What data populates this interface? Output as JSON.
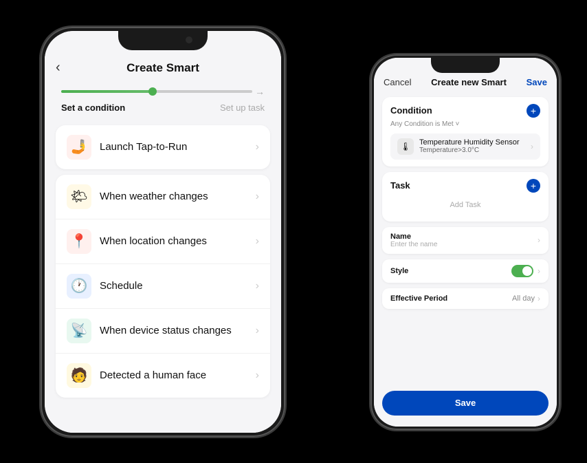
{
  "phone1": {
    "title": "Create Smart",
    "back_icon": "‹",
    "progress": {
      "step1_label": "Set a condition",
      "step2_label": "Set up task"
    },
    "rows": [
      {
        "id": "tap-to-run",
        "icon": "🤳",
        "icon_bg": "#fff0ee",
        "label": "Launch Tap-to-Run"
      },
      {
        "id": "weather",
        "icon": "🌤",
        "icon_bg": "#fff9e6",
        "label": "When weather changes"
      },
      {
        "id": "location",
        "icon": "📍",
        "icon_bg": "#fff0ee",
        "label": "When location changes"
      },
      {
        "id": "schedule",
        "icon": "🕐",
        "icon_bg": "#e8f0ff",
        "label": "Schedule"
      },
      {
        "id": "device-status",
        "icon": "📡",
        "icon_bg": "#e8f8f0",
        "label": "When device status changes"
      },
      {
        "id": "human-face",
        "icon": "🧑",
        "icon_bg": "#fff9e0",
        "label": "Detected a human face"
      }
    ]
  },
  "phone2": {
    "header": {
      "cancel": "Cancel",
      "title": "Create new Smart",
      "save": "Save"
    },
    "condition": {
      "section_title": "Condition",
      "subtitle": "Any Condition is Met ˅",
      "plus_icon": "+",
      "item": {
        "icon": "🌡",
        "name": "Temperature Humidity Sensor",
        "value": "Temperature>3.0°C",
        "chevron": "›"
      }
    },
    "task": {
      "section_title": "Task",
      "plus_icon": "+",
      "add_label": "Add Task"
    },
    "name": {
      "label": "Name",
      "placeholder": "Enter the name",
      "chevron": "›"
    },
    "style": {
      "label": "Style",
      "chevron": "›"
    },
    "effective_period": {
      "label": "Effective Period",
      "value": "All day",
      "chevron": "›"
    },
    "bottom_btn": "Save"
  }
}
